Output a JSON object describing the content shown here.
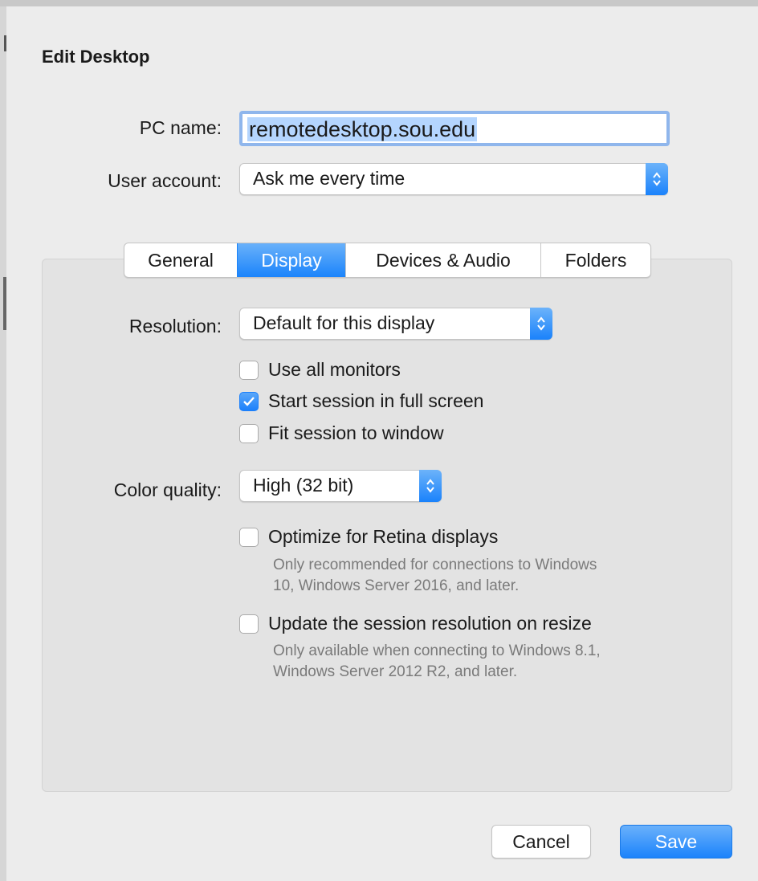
{
  "dialog": {
    "title": "Edit Desktop"
  },
  "form": {
    "pc_name_label": "PC name:",
    "pc_name_value": "remotedesktop.sou.edu",
    "user_account_label": "User account:",
    "user_account_value": "Ask me every time"
  },
  "tabs": [
    {
      "label": "General",
      "active": false
    },
    {
      "label": "Display",
      "active": true
    },
    {
      "label": "Devices & Audio",
      "active": false
    },
    {
      "label": "Folders",
      "active": false
    }
  ],
  "display": {
    "resolution_label": "Resolution:",
    "resolution_value": "Default for this display",
    "options": [
      {
        "label": "Use all monitors",
        "checked": false
      },
      {
        "label": "Start session in full screen",
        "checked": true
      },
      {
        "label": "Fit session to window",
        "checked": false
      }
    ],
    "color_quality_label": "Color quality:",
    "color_quality_value": "High (32 bit)",
    "retina": {
      "label": "Optimize for Retina displays",
      "checked": false,
      "note_line1": "Only recommended for connections to Windows",
      "note_line2": "10, Windows Server 2016, and later."
    },
    "resize": {
      "label": "Update the session resolution on resize",
      "checked": false,
      "note_line1": "Only available when connecting to Windows 8.1,",
      "note_line2": "Windows Server 2012 R2, and later."
    }
  },
  "buttons": {
    "cancel": "Cancel",
    "save": "Save"
  },
  "colors": {
    "accent": "#1b84fb",
    "note_text": "#7a7a7a",
    "panel": "#e3e3e3"
  }
}
